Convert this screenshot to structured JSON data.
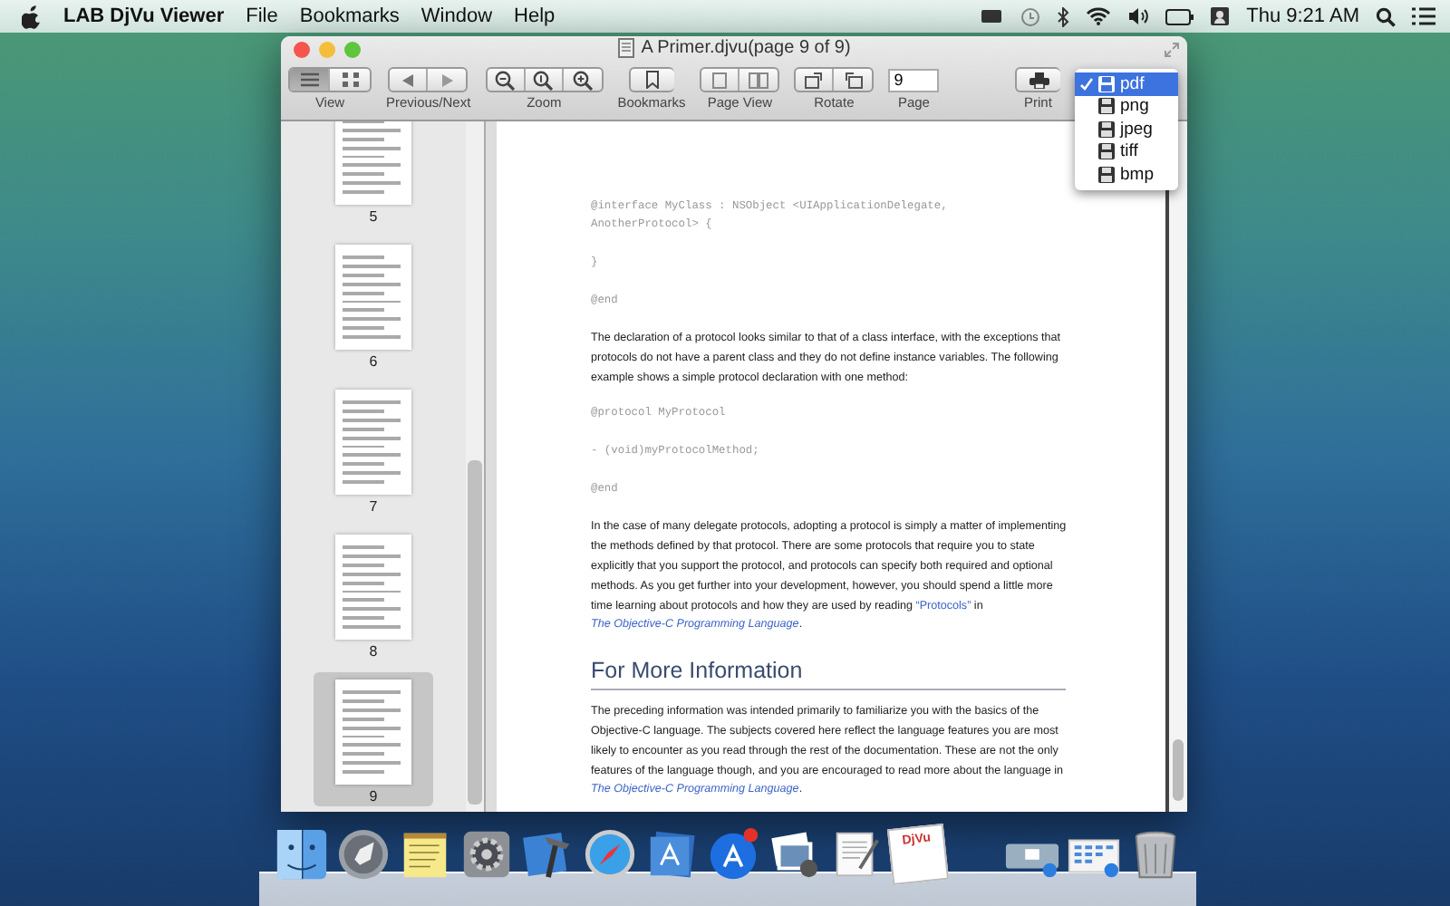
{
  "menu_bar": {
    "app_name": "LAB DjVu Viewer",
    "menus": [
      "File",
      "Bookmarks",
      "Window",
      "Help"
    ],
    "clock": "Thu 9:21 AM"
  },
  "window": {
    "title": "A Primer.djvu(page 9 of 9)"
  },
  "toolbar": [
    {
      "kind": "view",
      "label": "View",
      "segments": [
        {
          "selected": true
        },
        {
          "selected": false
        }
      ]
    },
    {
      "kind": "nav",
      "label": "Previous/Next"
    },
    {
      "kind": "zoom",
      "label": "Zoom"
    },
    {
      "kind": "bookmarks",
      "label": "Bookmarks"
    },
    {
      "kind": "page_view",
      "label": "Page View"
    },
    {
      "kind": "rotate",
      "label": "Rotate"
    },
    {
      "kind": "page",
      "label": "Page",
      "value": "9"
    },
    {
      "kind": "print",
      "label": "Print"
    }
  ],
  "export_menu": [
    {
      "label": "pdf",
      "selected": true
    },
    {
      "label": "png",
      "selected": false
    },
    {
      "label": "jpeg",
      "selected": false
    },
    {
      "label": "tiff",
      "selected": false
    },
    {
      "label": "bmp",
      "selected": false
    }
  ],
  "thumbnails": [
    {
      "page": "5",
      "selected": false
    },
    {
      "page": "6",
      "selected": false
    },
    {
      "page": "7",
      "selected": false
    },
    {
      "page": "8",
      "selected": false
    },
    {
      "page": "9",
      "selected": true
    }
  ],
  "document": [
    {
      "kind": "code",
      "lines": [
        "@interface MyClass : NSObject <UIApplicationDelegate,",
        "AnotherProtocol> {"
      ]
    },
    {
      "kind": "code",
      "lines": [
        "}"
      ]
    },
    {
      "kind": "code",
      "lines": [
        "@end"
      ]
    },
    {
      "kind": "para",
      "parts": [
        {
          "kind": "text",
          "text": "The declaration of a protocol looks similar to that of a class interface, with the exceptions that protocols do not have a parent class and they do not define instance variables. The following example shows a simple protocol declaration with one method:"
        }
      ]
    },
    {
      "kind": "code",
      "lines": [
        "@protocol MyProtocol"
      ]
    },
    {
      "kind": "code",
      "lines": [
        "- (void)myProtocolMethod;"
      ]
    },
    {
      "kind": "code",
      "lines": [
        "@end"
      ]
    },
    {
      "kind": "para",
      "parts": [
        {
          "kind": "text",
          "text": "In the case of many delegate protocols, adopting a protocol is simply a matter of implementing the methods defined by that protocol. There are some protocols that require you to state explicitly that you support the protocol, and protocols can specify both required and optional methods. As you get further into your development, however, you should spend a little more time learning about protocols and how they are used by reading "
        },
        {
          "kind": "link",
          "text": "“Protocols”"
        },
        {
          "kind": "text",
          "text": " in "
        },
        {
          "kind": "book_link",
          "text": "The Objective-C Programming Language"
        },
        {
          "kind": "text",
          "text": "."
        }
      ]
    },
    {
      "kind": "heading",
      "text": "For More Information"
    },
    {
      "kind": "para",
      "parts": [
        {
          "kind": "text",
          "text": "The preceding information was intended primarily to familiarize you with the basics of the Objective-C language. The subjects covered here reflect the language features you are most likely to encounter as you read through the rest of the documentation. These are not the only features of the language though, and you are encouraged to read more about the language in "
        },
        {
          "kind": "book_link",
          "text": "The Objective-C Programming Language"
        },
        {
          "kind": "text",
          "text": "."
        }
      ]
    }
  ],
  "dock": {
    "document_icon_label": "DjVu"
  }
}
